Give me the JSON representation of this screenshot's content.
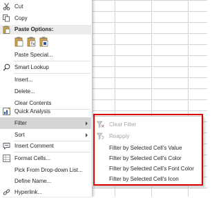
{
  "menu": {
    "cut": "Cut",
    "copy": "Copy",
    "paste_options": "Paste Options:",
    "paste_special": "Paste Special...",
    "smart_lookup": "Smart Lookup",
    "insert": "Insert...",
    "delete": "Delete...",
    "clear_contents": "Clear Contents",
    "quick_analysis": "Quick Analysis",
    "filter": "Filter",
    "sort": "Sort",
    "insert_comment": "Insert Comment",
    "format_cells": "Format Cells...",
    "pick_list": "Pick From Drop-down List...",
    "define_name": "Define Name...",
    "hyperlink": "Hyperlink..."
  },
  "filter_submenu": {
    "clear_filter": "Clear Filter",
    "reapply": "Reapply",
    "by_value": "Filter by Selected Cell's Value",
    "by_color": "Filter by Selected Cell's Color",
    "by_font_color": "Filter by Selected Cell's Font Color",
    "by_icon": "Filter by Selected Cell's Icon"
  },
  "colors": {
    "highlight": "#d6d6d6",
    "annotation_red": "#e00000",
    "accent_blue": "#2b579a"
  }
}
